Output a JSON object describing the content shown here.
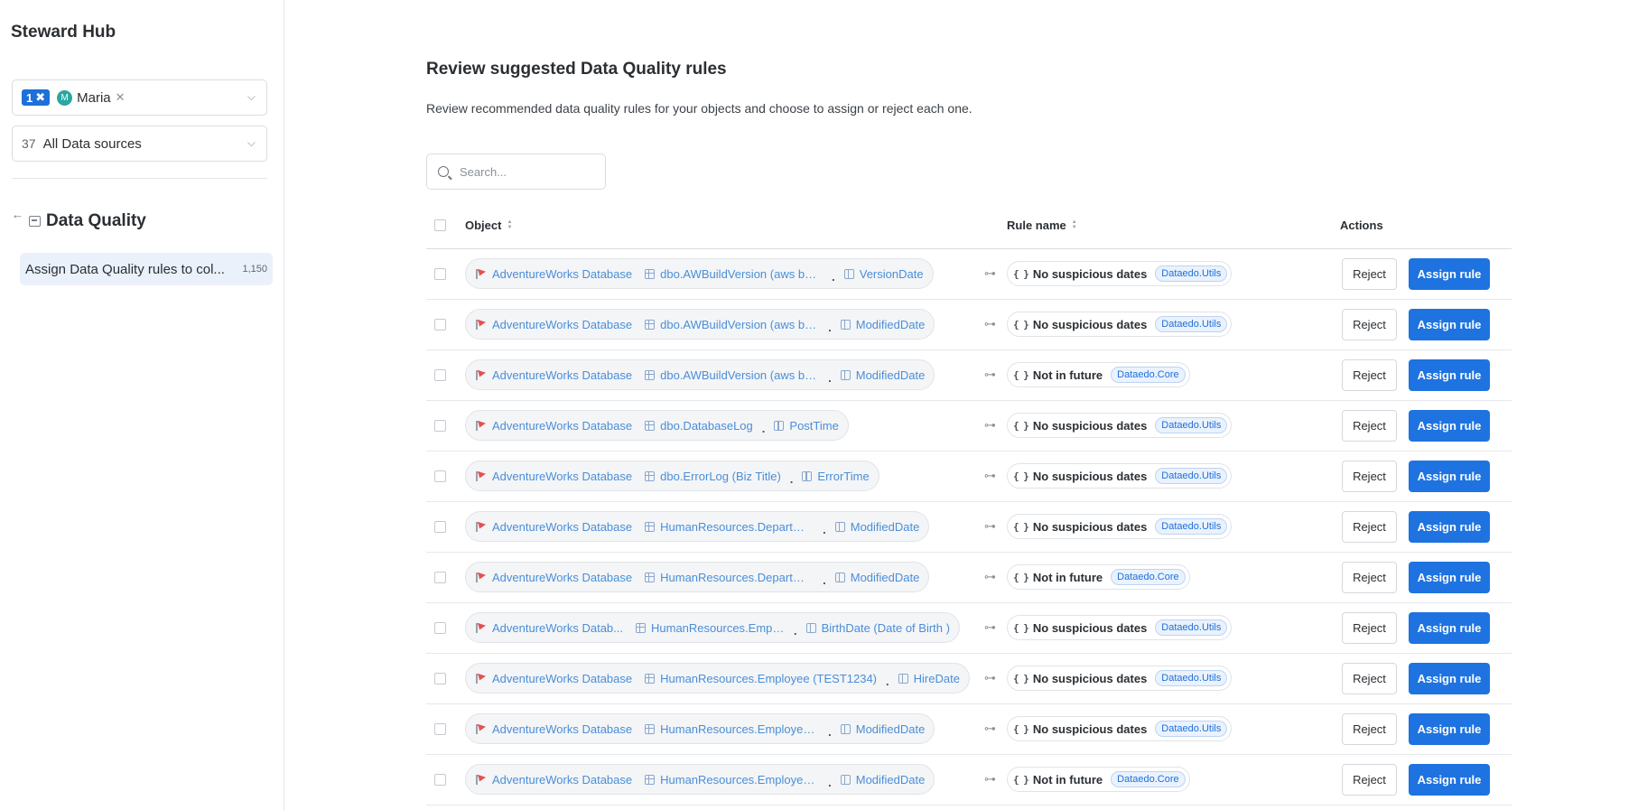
{
  "app": {
    "title": "Steward Hub"
  },
  "filters": {
    "owner": {
      "count": "1",
      "chip_initial": "M",
      "chip_label": "Maria"
    },
    "sources": {
      "count": "37",
      "label": "All Data sources"
    }
  },
  "section": {
    "title": "Data Quality"
  },
  "nav": {
    "item_label": "Assign Data Quality rules to col...",
    "item_count": "1,150"
  },
  "page": {
    "title": "Review suggested Data Quality rules",
    "description": "Review recommended data quality rules for your objects and choose to assign or reject each one."
  },
  "search": {
    "placeholder": "Search..."
  },
  "table": {
    "headers": {
      "object": "Object",
      "rule": "Rule name",
      "actions": "Actions"
    },
    "reject_label": "Reject",
    "assign_label": "Assign rule",
    "rows": [
      {
        "db": "AdventureWorks Database",
        "table": "dbo.AWBuildVersion (aws build ver...",
        "column": "VersionDate",
        "rule": "No suspicious dates",
        "tag": "Dataedo.Utils"
      },
      {
        "db": "AdventureWorks Database",
        "table": "dbo.AWBuildVersion (aws build ve...",
        "column": "ModifiedDate",
        "rule": "No suspicious dates",
        "tag": "Dataedo.Utils"
      },
      {
        "db": "AdventureWorks Database",
        "table": "dbo.AWBuildVersion (aws build ve...",
        "column": "ModifiedDate",
        "rule": "Not in future",
        "tag": "Dataedo.Core"
      },
      {
        "db": "AdventureWorks Database",
        "table": "dbo.DatabaseLog",
        "column": "PostTime",
        "rule": "No suspicious dates",
        "tag": "Dataedo.Utils"
      },
      {
        "db": "AdventureWorks Database",
        "table": "dbo.ErrorLog (Biz Title)",
        "column": "ErrorTime",
        "rule": "No suspicious dates",
        "tag": "Dataedo.Utils"
      },
      {
        "db": "AdventureWorks Database",
        "table": "HumanResources.Department",
        "column": "ModifiedDate",
        "rule": "No suspicious dates",
        "tag": "Dataedo.Utils"
      },
      {
        "db": "AdventureWorks Database",
        "table": "HumanResources.Department",
        "column": "ModifiedDate",
        "rule": "Not in future",
        "tag": "Dataedo.Core"
      },
      {
        "db": "AdventureWorks Datab...",
        "table": "HumanResources.Empl...",
        "column": "BirthDate (Date of Birth )",
        "rule": "No suspicious dates",
        "tag": "Dataedo.Utils"
      },
      {
        "db": "AdventureWorks Database",
        "table": "HumanResources.Employee (TEST1234)",
        "column": "HireDate",
        "rule": "No suspicious dates",
        "tag": "Dataedo.Utils"
      },
      {
        "db": "AdventureWorks Database",
        "table": "HumanResources.Employee (TES...",
        "column": "ModifiedDate",
        "rule": "No suspicious dates",
        "tag": "Dataedo.Utils"
      },
      {
        "db": "AdventureWorks Database",
        "table": "HumanResources.Employee (TES...",
        "column": "ModifiedDate",
        "rule": "Not in future",
        "tag": "Dataedo.Core"
      }
    ]
  }
}
